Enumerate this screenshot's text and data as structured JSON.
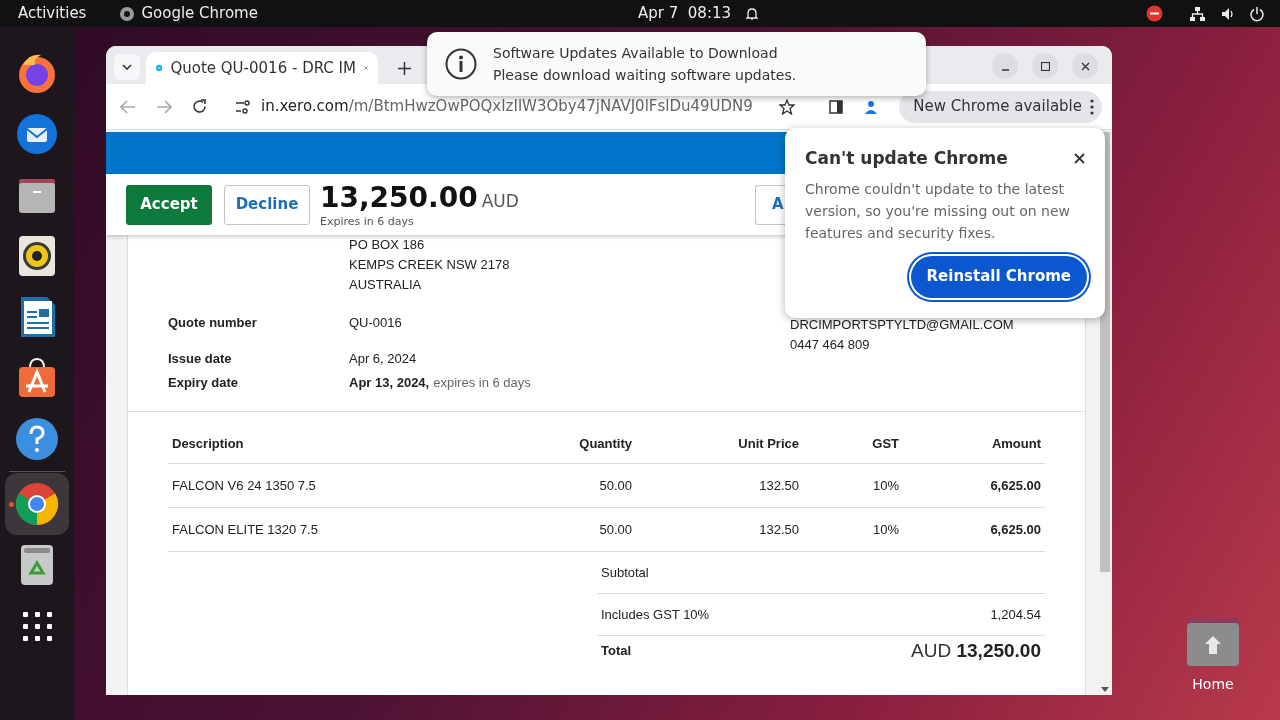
{
  "top_bar": {
    "activities": "Activities",
    "app": "Google Chrome",
    "clock": "Apr 7  08:13"
  },
  "dock": [
    {
      "kind": "firefox",
      "running": false
    },
    {
      "kind": "thunderbird",
      "running": false
    },
    {
      "kind": "files",
      "running": false
    },
    {
      "kind": "rhythmbox",
      "running": false
    },
    {
      "kind": "writer",
      "running": false
    },
    {
      "kind": "appcenter",
      "running": false
    },
    {
      "kind": "help",
      "running": false
    },
    {
      "kind": "chrome",
      "running": true
    },
    {
      "kind": "trash",
      "running": false
    },
    {
      "kind": "apps",
      "running": false
    }
  ],
  "browser": {
    "tab": {
      "title": "Quote QU-0016 - DRC IM"
    },
    "url_host": "in.xero.com",
    "url_path": "/m/BtmHwzOwPOQxIzIlW3Oby47jNAVJ0lFslDu49UDN9",
    "update_chip": "New Chrome available"
  },
  "quote_bar": {
    "accept": "Accept",
    "decline": "Decline",
    "total": "13,250.00",
    "currency": "AUD",
    "expires": "Expires in 6 days",
    "cut_button": "A"
  },
  "address": [
    "PO BOX 186",
    "KEMPS CREEK NSW 2178",
    "AUSTRALIA"
  ],
  "details": [
    {
      "label": "Quote number",
      "value": "QU-0016"
    },
    {
      "label": "Issue date",
      "value": "Apr 6, 2024"
    },
    {
      "label": "Expiry date",
      "value": "Apr 13, 2024,",
      "note": "expires in 6 days"
    }
  ],
  "contact": [
    "DRCIMPORTSPTYLTD@GMAIL.COM",
    "0447 464 809"
  ],
  "table": {
    "columns": [
      "Description",
      "Quantity",
      "Unit Price",
      "GST",
      "Amount"
    ],
    "rows": [
      [
        "FALCON V6 24 1350 7.5",
        "50.00",
        "132.50",
        "10%",
        "6,625.00"
      ],
      [
        "FALCON ELITE 1320 7.5",
        "50.00",
        "132.50",
        "10%",
        "6,625.00"
      ]
    ]
  },
  "totals": [
    {
      "label": "Subtotal"
    },
    {
      "label": "Includes GST 10%",
      "value": "1,204.54"
    }
  ],
  "total": {
    "label": "Total",
    "currency": "AUD",
    "amount": "13,250.00"
  },
  "notification": {
    "title": "Software Updates Available to Download",
    "body": "Please download waiting software updates."
  },
  "popup": {
    "title": "Can't update Chrome",
    "body": "Chrome couldn't update to the latest version, so you're missing out on new features and security fixes.",
    "button": "Reinstall Chrome"
  },
  "desktop_icons": [
    {
      "label": "Home"
    }
  ]
}
